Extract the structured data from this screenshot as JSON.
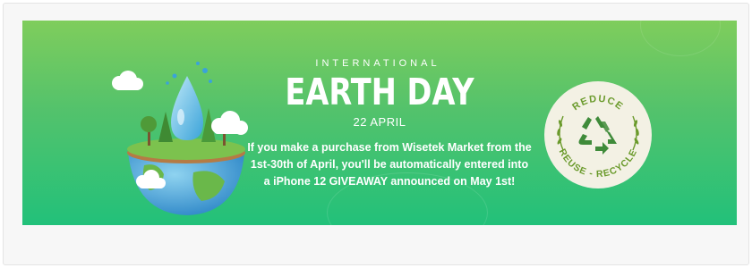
{
  "banner": {
    "eyebrow": "INTERNATIONAL",
    "headline": "EARTH DAY",
    "date": "22 APRIL",
    "promo_lines": [
      "If you make a purchase from Wisetek Market from the",
      "1st-30th of April, you'll be automatically entered into",
      "a iPhone 12 GIVEAWAY announced on May 1st!"
    ]
  },
  "badge": {
    "top_text": "REDUCE",
    "bottom_text": "REUSE - RECYCLE",
    "icon": "recycle-icon"
  },
  "illustration": {
    "icon": "earth-water-drop-illustration"
  },
  "colors": {
    "banner_top": "#7fcd5c",
    "banner_bottom": "#22c17a",
    "badge_fill": "#f3f1e4",
    "badge_green": "#6a9a2b",
    "recycle_green": "#3f8b3a"
  }
}
